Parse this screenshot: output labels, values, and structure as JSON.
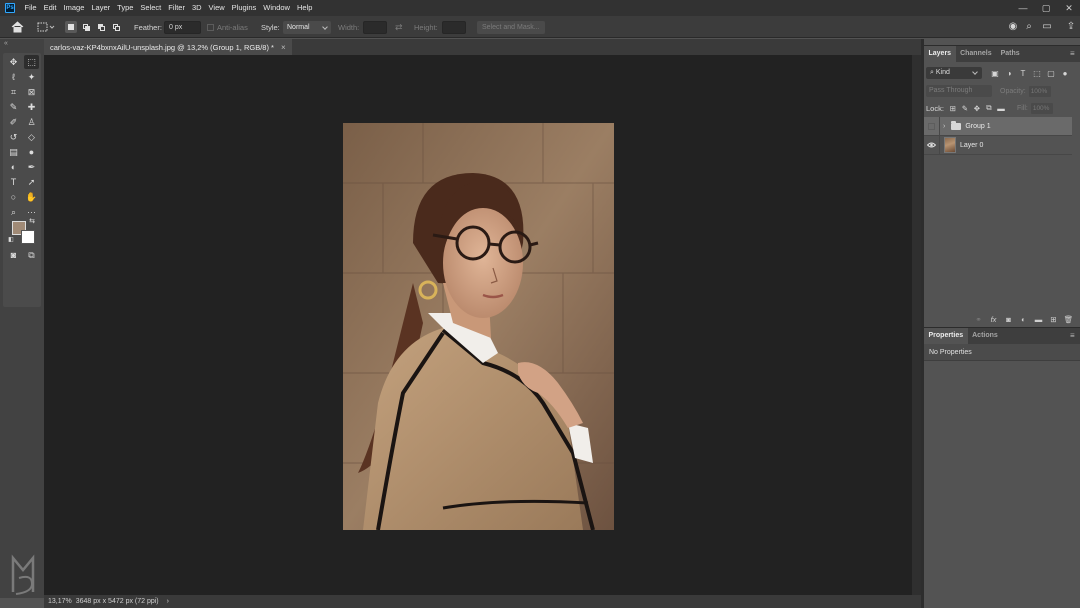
{
  "app": {
    "logo_text": "Ps"
  },
  "menu": [
    "File",
    "Edit",
    "Image",
    "Layer",
    "Type",
    "Select",
    "Filter",
    "3D",
    "View",
    "Plugins",
    "Window",
    "Help"
  ],
  "window_controls": {
    "minimize": "—",
    "maximize": "▢",
    "close": "✕"
  },
  "options_bar": {
    "feather_label": "Feather:",
    "feather_value": "0 px",
    "antialias_label": "Anti-alias",
    "style_label": "Style:",
    "style_value": "Normal",
    "width_label": "Width:",
    "height_label": "Height:",
    "select_mask_label": "Select and Mask..."
  },
  "document": {
    "tab_title": "carlos-vaz-KP4bxnxAilU-unsplash.jpg @ 13,2% (Group 1, RGB/8) *",
    "tab_close": "×"
  },
  "status_bar": {
    "zoom": "13,17%",
    "dimensions": "3648 px x 5472 px (72 ppi)",
    "arrow": "›"
  },
  "colors": {
    "foreground": "#a08a76",
    "background": "#ffffff",
    "accent": "#31a8ff"
  },
  "layers_panel": {
    "tabs": [
      "Layers",
      "Channels",
      "Paths"
    ],
    "kind_label": "Kind",
    "blend_mode": "Pass Through",
    "opacity_label": "Opacity:",
    "opacity_value": "100%",
    "lock_label": "Lock:",
    "fill_label": "Fill:",
    "fill_value": "100%",
    "layers": [
      {
        "name": "Group 1",
        "type": "group",
        "visible": false,
        "selected": true
      },
      {
        "name": "Layer 0",
        "type": "pixel",
        "visible": true,
        "selected": false
      }
    ]
  },
  "properties_panel": {
    "tabs": [
      "Properties",
      "Actions"
    ],
    "content": "No Properties"
  }
}
